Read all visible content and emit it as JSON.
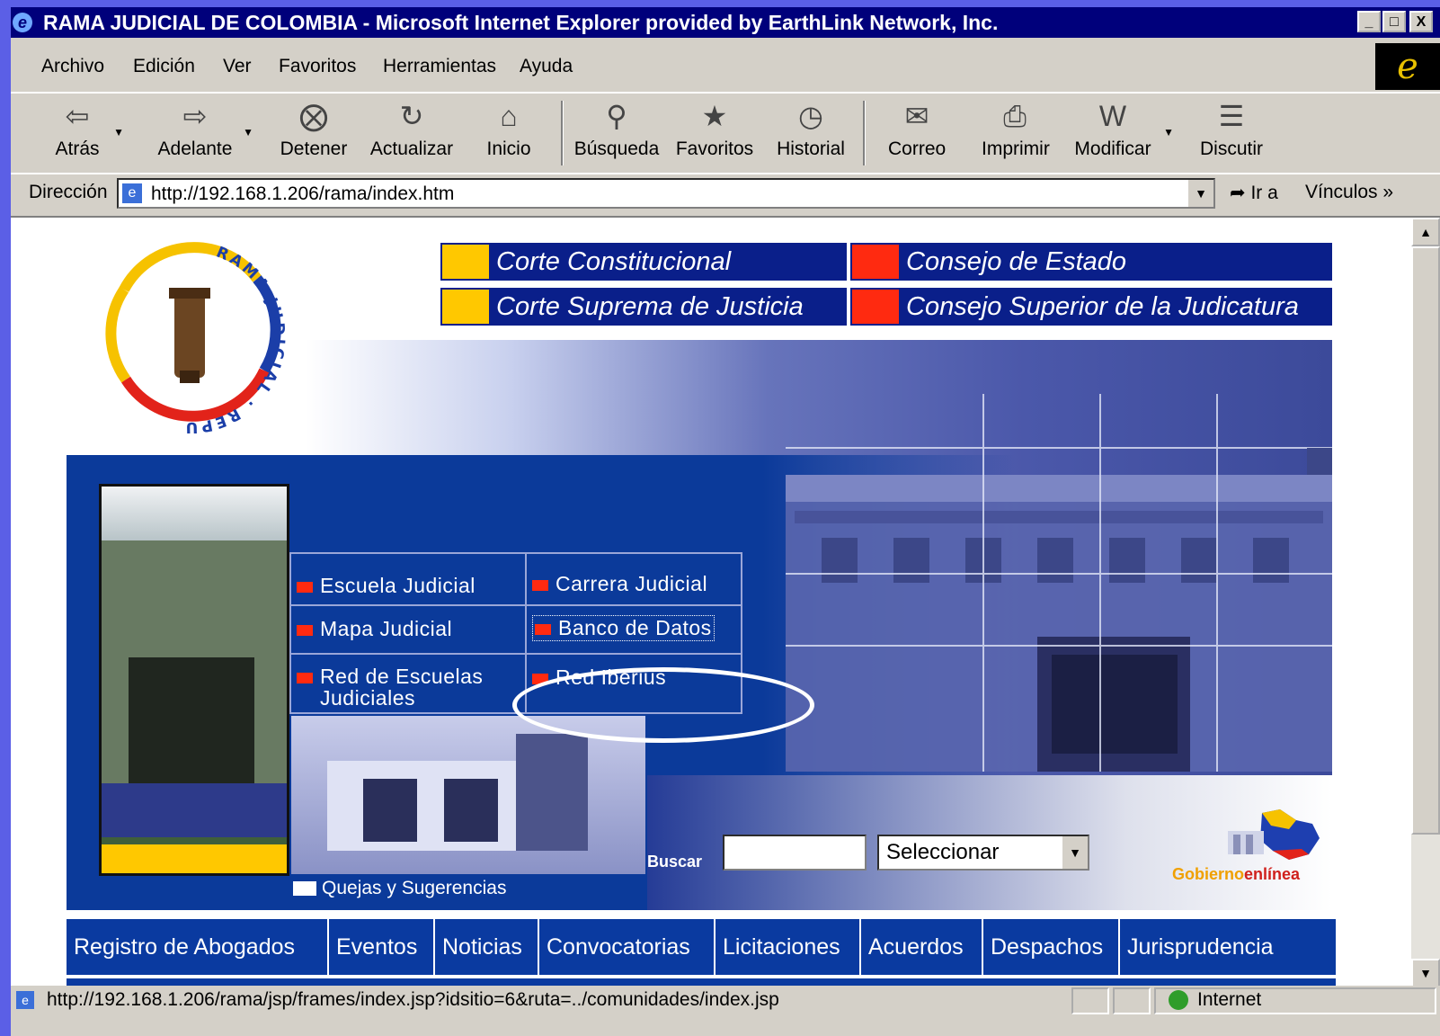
{
  "window": {
    "title": "RAMA JUDICIAL DE COLOMBIA - Microsoft Internet Explorer provided by EarthLink Network, Inc.",
    "controls": [
      "_",
      "□",
      "X"
    ]
  },
  "menu": [
    "Archivo",
    "Edición",
    "Ver",
    "Favoritos",
    "Herramientas",
    "Ayuda"
  ],
  "toolbar": {
    "back": "Atrás",
    "forward": "Adelante",
    "stop": "Detener",
    "refresh": "Actualizar",
    "home": "Inicio",
    "search": "Búsqueda",
    "favorites": "Favoritos",
    "history": "Historial",
    "mail": "Correo",
    "print": "Imprimir",
    "edit": "Modificar",
    "discuss": "Discutir"
  },
  "address": {
    "label": "Dirección",
    "url": "http://192.168.1.206/rama/index.htm",
    "go": "Ir a",
    "links": "Vínculos"
  },
  "site": {
    "logo_text": "RAMA JUDICIAL · REPÚBLICA DE COLOMBIA ·",
    "top_nav": [
      {
        "label": "Corte Constitucional",
        "color": "#ffc800"
      },
      {
        "label": "Consejo de Estado",
        "color": "#ff2a10"
      },
      {
        "label": "Corte Suprema de Justicia",
        "color": "#ffc800"
      },
      {
        "label": "Consejo Superior de la Judicatura",
        "color": "#ff2a10"
      }
    ],
    "grid_menu": {
      "escuela": "Escuela Judicial",
      "carrera": "Carrera Judicial",
      "mapa": "Mapa Judicial",
      "banco": "Banco de Datos",
      "red_escuelas_1": "Red de Escuelas",
      "red_escuelas_2": "Judiciales",
      "red_iberius": "Red Iberius"
    },
    "quejas": "Quejas y Sugerencias",
    "search_label": "Buscar",
    "select_value": "Seleccionar",
    "gobierno_1": "Gobierno",
    "gobierno_2": "enlínea",
    "bottom_nav": [
      "Registro de Abogados",
      "Eventos",
      "Noticias",
      "Convocatorias",
      "Licitaciones",
      "Acuerdos",
      "Despachos",
      "Jurisprudencia"
    ]
  },
  "status": {
    "url": "http://192.168.1.206/rama/jsp/frames/index.jsp?idsitio=6&ruta=../comunidades/index.jsp",
    "zone": "Internet"
  }
}
